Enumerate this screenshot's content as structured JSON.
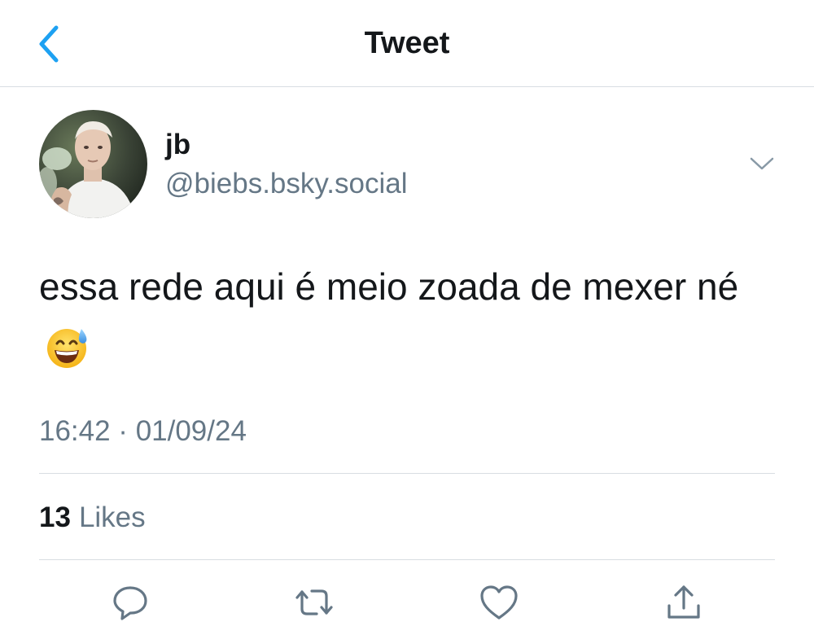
{
  "header": {
    "title": "Tweet",
    "back_icon": "chevron-left-icon"
  },
  "author": {
    "display_name": "jb",
    "handle": "@biebs.bsky.social",
    "avatar": "profile-photo"
  },
  "tweet": {
    "text": "essa rede aqui é meio zoada de mexer né",
    "emoji": "grinning-face-with-sweat-emoji",
    "timestamp": "16:42 · 01/09/24"
  },
  "stats": {
    "likes_count": "13",
    "likes_label": "Likes"
  },
  "actions": [
    {
      "name": "reply",
      "icon": "reply-icon"
    },
    {
      "name": "retweet",
      "icon": "retweet-icon"
    },
    {
      "name": "like",
      "icon": "heart-icon"
    },
    {
      "name": "share",
      "icon": "share-icon"
    }
  ],
  "colors": {
    "accent": "#1da1f2",
    "text": "#14171a",
    "secondary": "#657786",
    "divider": "#d8dde2",
    "icon": "#657786"
  }
}
